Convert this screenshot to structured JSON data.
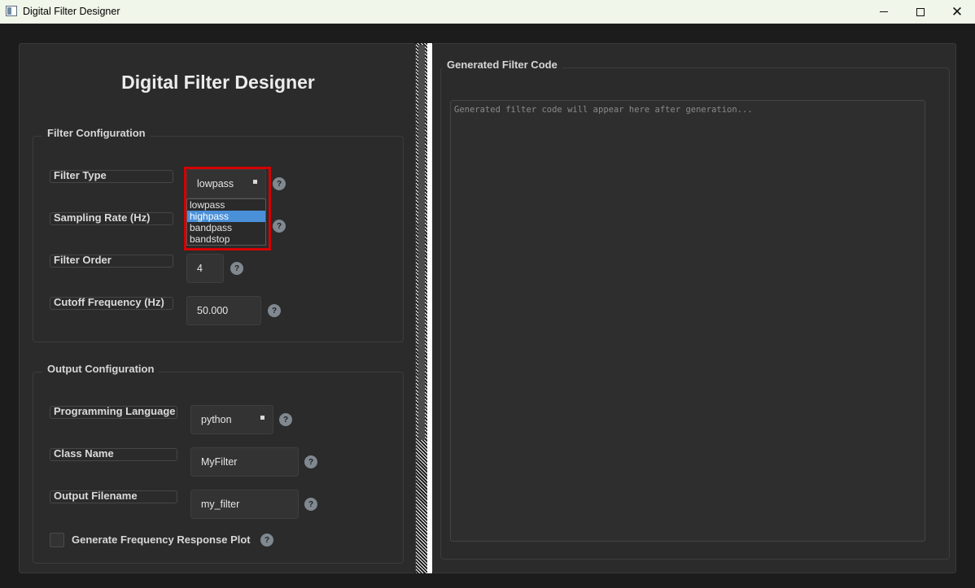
{
  "window": {
    "title": "Digital Filter Designer"
  },
  "left_panel": {
    "heading": "Digital Filter Designer",
    "filter_config": {
      "title": "Filter Configuration",
      "filter_type": {
        "label": "Filter Type",
        "value": "lowpass",
        "options": [
          "lowpass",
          "highpass",
          "bandpass",
          "bandstop"
        ],
        "highlighted_option": "highpass"
      },
      "sampling_rate": {
        "label": "Sampling Rate (Hz)"
      },
      "filter_order": {
        "label": "Filter Order",
        "value": "4"
      },
      "cutoff": {
        "label": "Cutoff Frequency (Hz)",
        "value": "50.000"
      }
    },
    "output_config": {
      "title": "Output Configuration",
      "language": {
        "label": "Programming Language",
        "value": "python"
      },
      "class_name": {
        "label": "Class Name",
        "value": "MyFilter"
      },
      "filename": {
        "label": "Output Filename",
        "value": "my_filter"
      },
      "plot_checkbox": {
        "label": "Generate Frequency Response Plot",
        "checked": false
      }
    },
    "help_glyph": "?"
  },
  "right_panel": {
    "title": "Generated Filter Code",
    "placeholder": "Generated filter code will appear here after generation..."
  },
  "colors": {
    "background": "#1c1c1c",
    "panel": "#2b2b2b",
    "selection": "#4a90d9",
    "highlight_border": "#d40000",
    "titlebar": "#f0f6ea"
  }
}
